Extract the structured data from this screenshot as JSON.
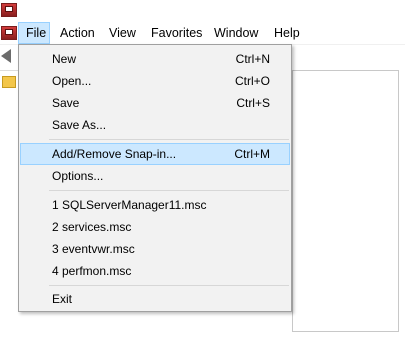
{
  "menubar": {
    "items": [
      {
        "label": "File"
      },
      {
        "label": "Action"
      },
      {
        "label": "View"
      },
      {
        "label": "Favorites"
      },
      {
        "label": "Window"
      },
      {
        "label": "Help"
      }
    ]
  },
  "file_menu": {
    "items": [
      {
        "label": "New",
        "shortcut": "Ctrl+N"
      },
      {
        "label": "Open...",
        "shortcut": "Ctrl+O"
      },
      {
        "label": "Save",
        "shortcut": "Ctrl+S"
      },
      {
        "label": "Save As...",
        "shortcut": ""
      },
      {
        "label": "Add/Remove Snap-in...",
        "shortcut": "Ctrl+M"
      },
      {
        "label": "Options...",
        "shortcut": ""
      },
      {
        "label": "1 SQLServerManager11.msc",
        "shortcut": ""
      },
      {
        "label": "2 services.msc",
        "shortcut": ""
      },
      {
        "label": "3 eventvwr.msc",
        "shortcut": ""
      },
      {
        "label": "4 perfmon.msc",
        "shortcut": ""
      },
      {
        "label": "Exit",
        "shortcut": ""
      }
    ]
  },
  "colors": {
    "highlight": "#cce8ff",
    "highlight_border": "#99d1ff",
    "menu_background": "#f2f2f2"
  }
}
